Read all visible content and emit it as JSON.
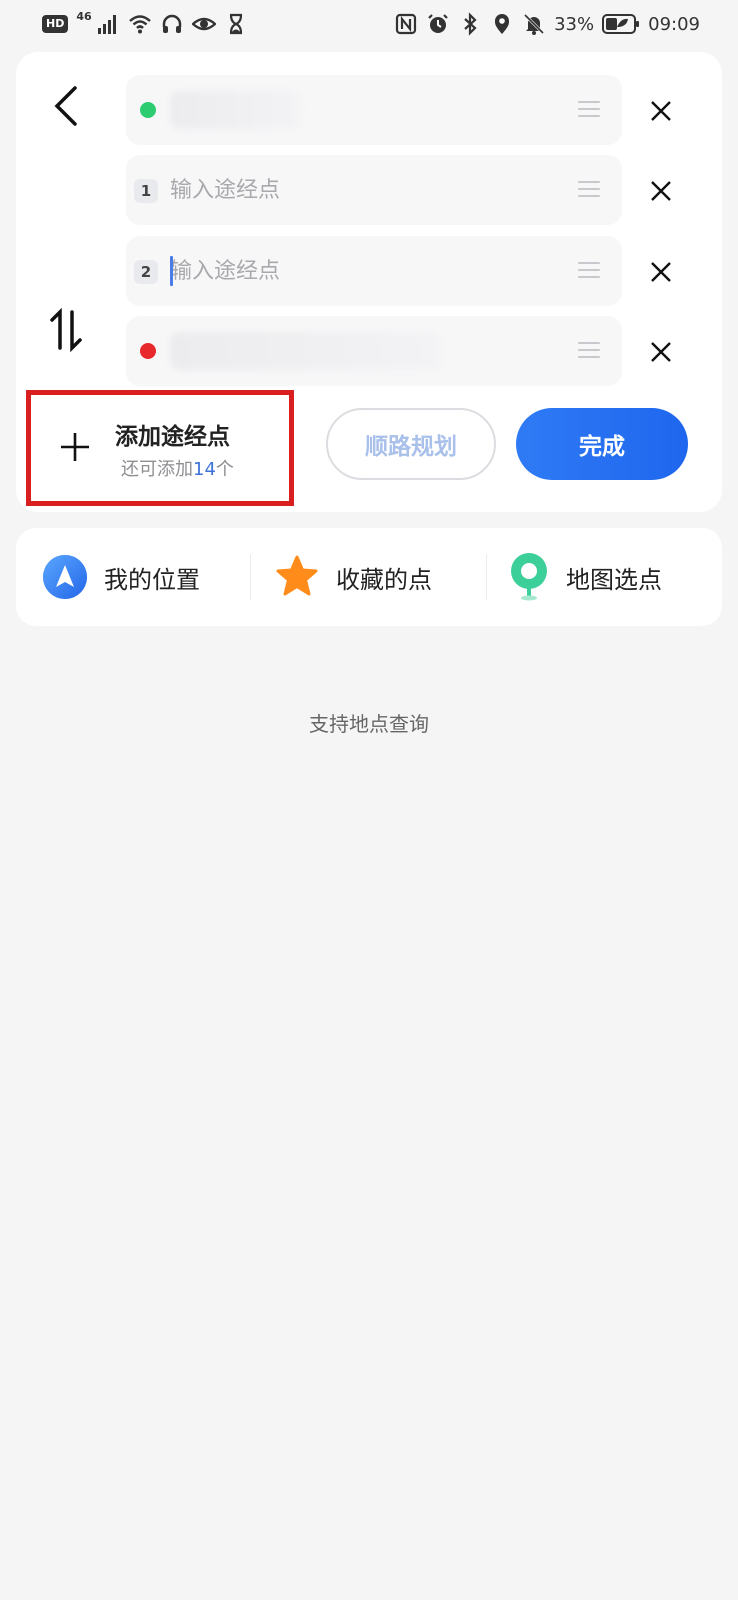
{
  "status_bar": {
    "hd": "HD",
    "network": "46",
    "battery": "33%",
    "time": "09:09"
  },
  "stops": [
    {
      "type": "start",
      "dot_color": "#2ecc71",
      "value": ""
    },
    {
      "type": "waypoint",
      "number": "1",
      "placeholder": "输入途经点",
      "value": ""
    },
    {
      "type": "waypoint",
      "number": "2",
      "placeholder": "输入途经点",
      "value": ""
    },
    {
      "type": "end",
      "dot_color": "#e8292b",
      "value": ""
    }
  ],
  "add_waypoint": {
    "title": "添加途经点",
    "sub_prefix": "还可添加",
    "count": "14",
    "sub_suffix": "个"
  },
  "buttons": {
    "along_route": "顺路规划",
    "done": "完成"
  },
  "quick_picks": [
    {
      "label": "我的位置",
      "icon": "location-arrow-icon"
    },
    {
      "label": "收藏的点",
      "icon": "star-icon"
    },
    {
      "label": "地图选点",
      "icon": "map-pin-icon"
    }
  ],
  "hint": "支持地点查询",
  "colors": {
    "accent": "#2f7bf5",
    "highlight_border": "#d91f1f",
    "start_dot": "#2ecc71",
    "end_dot": "#e8292b",
    "star": "#ff8c1a",
    "pin": "#3ccf9a"
  }
}
